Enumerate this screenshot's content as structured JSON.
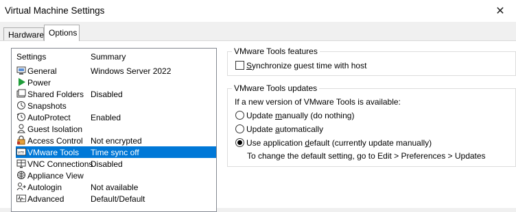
{
  "window": {
    "title": "Virtual Machine Settings",
    "close": "✕"
  },
  "tabs": [
    {
      "label": "Hardware"
    },
    {
      "label": "Options"
    }
  ],
  "list": {
    "header": {
      "settings": "Settings",
      "summary": "Summary"
    },
    "rows": [
      {
        "label": "General",
        "summary": "Windows Server 2022",
        "icon": "general-icon"
      },
      {
        "label": "Power",
        "summary": "",
        "icon": "power-icon"
      },
      {
        "label": "Shared Folders",
        "summary": "Disabled",
        "icon": "shared-folders-icon"
      },
      {
        "label": "Snapshots",
        "summary": "",
        "icon": "snapshots-icon"
      },
      {
        "label": "AutoProtect",
        "summary": "Enabled",
        "icon": "autoprotect-icon"
      },
      {
        "label": "Guest Isolation",
        "summary": "",
        "icon": "guest-isolation-icon"
      },
      {
        "label": "Access Control",
        "summary": "Not encrypted",
        "icon": "access-control-icon"
      },
      {
        "label": "VMware Tools",
        "summary": "Time sync off",
        "icon": "vmware-tools-icon",
        "selected": true
      },
      {
        "label": "VNC Connections",
        "summary": "Disabled",
        "icon": "vnc-icon"
      },
      {
        "label": "Appliance View",
        "summary": "",
        "icon": "appliance-view-icon"
      },
      {
        "label": "Autologin",
        "summary": "Not available",
        "icon": "autologin-icon"
      },
      {
        "label": "Advanced",
        "summary": "Default/Default",
        "icon": "advanced-icon"
      }
    ]
  },
  "features": {
    "title": "VMware Tools features",
    "sync_prefix": "",
    "sync_mnemonic": "S",
    "sync_rest": "ynchronize guest time with host",
    "sync_checked": false
  },
  "updates": {
    "title": "VMware Tools updates",
    "prompt": "If a new version of VMware Tools is available:",
    "opt1_a": "Update ",
    "opt1_m": "m",
    "opt1_b": "anually (do nothing)",
    "opt2_a": "Update ",
    "opt2_m": "a",
    "opt2_b": "utomatically",
    "opt3_a": "Use application ",
    "opt3_m": "d",
    "opt3_b": "efault (currently update manually)",
    "selected_option": 3,
    "note": "To change the default setting, go to Edit > Preferences > Updates"
  },
  "colors": {
    "selection": "#0078d7",
    "accent_green": "#1f9d3a"
  }
}
